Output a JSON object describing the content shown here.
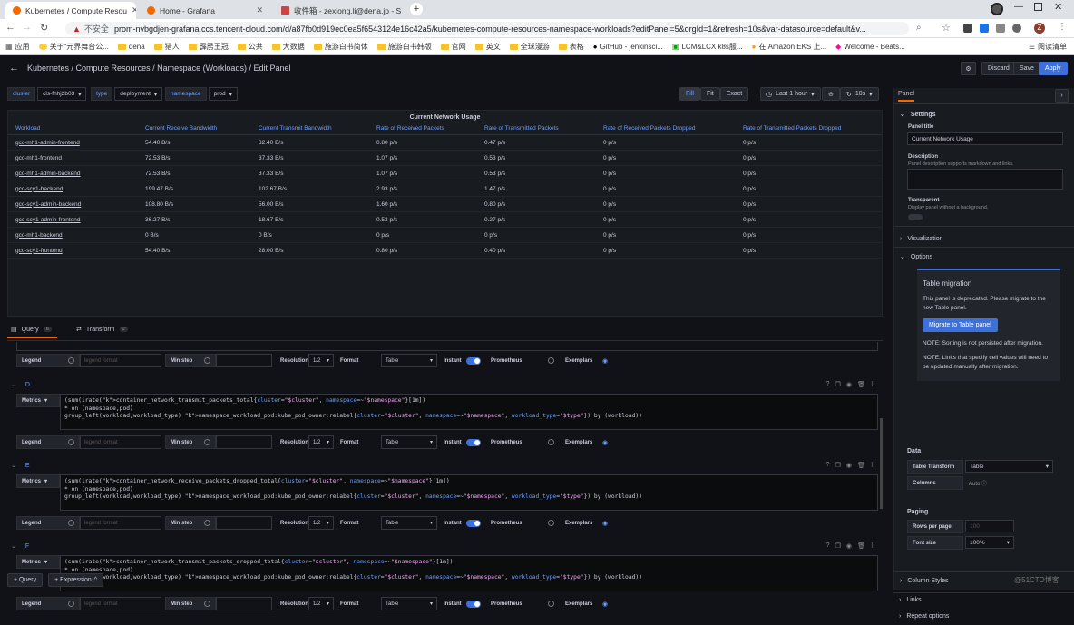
{
  "browser": {
    "tabs": [
      {
        "title": "Kubernetes / Compute Resou",
        "icon": "grafana-icon"
      },
      {
        "title": "Home - Grafana",
        "icon": "grafana-icon"
      },
      {
        "title": "收件箱 - zexiong.li@dena.jp - S",
        "icon": "mail-icon"
      }
    ],
    "security": "不安全",
    "url": "prom-nvbgdjen-grafana.ccs.tencent-cloud.com/d/a87fb0d919ec0ea5f6543124e16c42a5/kubernetes-compute-resources-namespace-workloads?editPanel=5&orgId=1&refresh=10s&var-datasource=default&v...",
    "bookmarks": [
      "应用",
      "关于“元界舞台公...",
      "dena",
      "猎人",
      "霹雳王冠",
      "公共",
      "大数据",
      "施游白书简体",
      "施游白书韩版",
      "官网",
      "英文",
      "全球漫游",
      "表格",
      "GitHub - jenkinsci...",
      "LCM&LCX k8s服...",
      "在 Amazon EKS 上...",
      "Welcome - Beats...",
      "阅读清单"
    ]
  },
  "header": {
    "breadcrumb": "Kubernetes / Compute Resources / Namespace (Workloads) / Edit Panel",
    "discard": "Discard",
    "save": "Save",
    "apply": "Apply"
  },
  "vars": [
    {
      "label": "cluster",
      "value": "cls-fhhj2b03"
    },
    {
      "label": "type",
      "value": "deployment"
    },
    {
      "label": "namespace",
      "value": "prod"
    }
  ],
  "toolbar": {
    "fill": "Fill",
    "fit": "Fit",
    "exact": "Exact",
    "time": "Last 1 hour",
    "refresh": "10s"
  },
  "panel": {
    "title": "Current Network Usage",
    "columns": [
      "Workload",
      "Current Receive Bandwidth",
      "Current Transmit Bandwidth",
      "Rate of Received Packets",
      "Rate of Transmitted Packets",
      "Rate of Received Packets Dropped",
      "Rate of Transmitted Packets Dropped"
    ],
    "rows": [
      [
        "gcc-mh1-admin-frontend",
        "54.40 B/s",
        "32.40 B/s",
        "0.80 p/s",
        "0.47 p/s",
        "0 p/s",
        "0 p/s"
      ],
      [
        "gcc-mh1-frontend",
        "72.53 B/s",
        "37.33 B/s",
        "1.07 p/s",
        "0.53 p/s",
        "0 p/s",
        "0 p/s"
      ],
      [
        "gcc-mh1-admin-backend",
        "72.53 B/s",
        "37.33 B/s",
        "1.07 p/s",
        "0.53 p/s",
        "0 p/s",
        "0 p/s"
      ],
      [
        "gcc-scy1-backend",
        "199.47 B/s",
        "102.67 B/s",
        "2.93 p/s",
        "1.47 p/s",
        "0 p/s",
        "0 p/s"
      ],
      [
        "gcc-scy1-admin-backend",
        "108.80 B/s",
        "56.00 B/s",
        "1.60 p/s",
        "0.80 p/s",
        "0 p/s",
        "0 p/s"
      ],
      [
        "gcc-scy1-admin-frontend",
        "36.27 B/s",
        "18.67 B/s",
        "0.53 p/s",
        "0.27 p/s",
        "0 p/s",
        "0 p/s"
      ],
      [
        "gcc-mh1-backend",
        "0 B/s",
        "0 B/s",
        "0 p/s",
        "0 p/s",
        "0 p/s",
        "0 p/s"
      ],
      [
        "gcc-scy1-frontend",
        "54.40 B/s",
        "28.00 B/s",
        "0.80 p/s",
        "0.40 p/s",
        "0 p/s",
        "0 p/s"
      ]
    ]
  },
  "querytabs": {
    "query": "Query",
    "query_count": "6",
    "transform": "Transform",
    "transform_count": "0"
  },
  "options": {
    "legend": "Legend",
    "legend_ph": "legend format",
    "minstep": "Min step",
    "resolution": "Resolution",
    "res_val": "1/2",
    "format": "Format",
    "format_val": "Table",
    "instant": "Instant",
    "prometheus": "Prometheus",
    "exemplars": "Exemplars",
    "metrics": "Metrics"
  },
  "queries": [
    {
      "letter": "D",
      "lines": [
        "(sum(irate(container_network_transmit_packets_total{cluster=\"$cluster\", namespace=~\"$namespace\"}[1m])",
        "* on (namespace,pod)",
        "group_left(workload,workload_type) namespace_workload_pod:kube_pod_owner:relabel{cluster=\"$cluster\", namespace=~\"$namespace\", workload_type=\"$type\"}) by (workload))"
      ]
    },
    {
      "letter": "E",
      "lines": [
        "(sum(irate(container_network_receive_packets_dropped_total{cluster=\"$cluster\", namespace=~\"$namespace\"}[1m])",
        "* on (namespace,pod)",
        "group_left(workload,workload_type) namespace_workload_pod:kube_pod_owner:relabel{cluster=\"$cluster\", namespace=~\"$namespace\", workload_type=\"$type\"}) by (workload))"
      ]
    },
    {
      "letter": "F",
      "lines": [
        "(sum(irate(container_network_transmit_packets_dropped_total{cluster=\"$cluster\", namespace=~\"$namespace\"}[1m])",
        "* on (namespace,pod)",
        "group_left(workload,workload_type) namespace_workload_pod:kube_pod_owner:relabel{cluster=\"$cluster\", namespace=~\"$namespace\", workload_type=\"$type\"}) by (workload))"
      ]
    }
  ],
  "bottom": {
    "query": "+ Query",
    "expression": "+ Expression"
  },
  "side": {
    "tab": "Panel",
    "settings": "Settings",
    "title_label": "Panel title",
    "title_value": "Current Network Usage",
    "desc_label": "Description",
    "desc_hint": "Panel description supports markdown and links.",
    "transparent_label": "Transparent",
    "transparent_hint": "Display panel without a background.",
    "visualization": "Visualization",
    "options": "Options",
    "migration_title": "Table migration",
    "migration_text": "This panel is deprecated. Please migrate to the new Table panel.",
    "migrate_button": "Migrate to Table panel",
    "note1": "NOTE: Sorting is not persisted after migration.",
    "note2": "NOTE: Links that specify cell values will need to be updated manually after migration.",
    "data": "Data",
    "table_transform": "Table Transform",
    "table_transform_val": "Table",
    "columns": "Columns",
    "columns_val": "Auto",
    "paging": "Paging",
    "rows_per_page": "Rows per page",
    "rows_per_page_ph": "100",
    "font_size": "Font size",
    "font_size_val": "100%",
    "column_styles": "Column Styles",
    "links": "Links",
    "repeat": "Repeat options"
  },
  "watermark": "@51CTO博客"
}
